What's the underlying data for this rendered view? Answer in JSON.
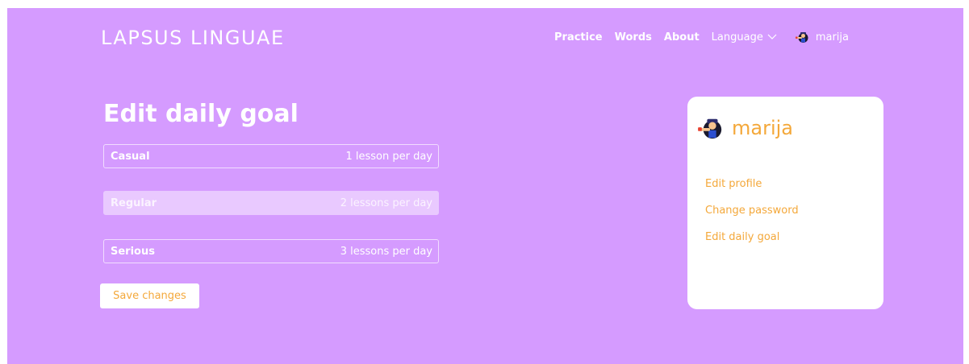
{
  "brand": "LAPSUS LINGUAE",
  "nav": {
    "practice": "Practice",
    "words": "Words",
    "about": "About",
    "language": "Language",
    "username": "marija"
  },
  "page_title": "Edit daily goal",
  "goals": [
    {
      "name": "Casual",
      "desc": "1 lesson per day",
      "selected": false
    },
    {
      "name": "Regular",
      "desc": "2 lessons per day",
      "selected": true
    },
    {
      "name": "Serious",
      "desc": "3 lessons per day",
      "selected": false
    }
  ],
  "save_label": "Save changes",
  "profile_card": {
    "username": "marija",
    "links": [
      "Edit profile",
      "Change password",
      "Edit daily goal"
    ]
  },
  "icons": {
    "avatar": "avatar-icon",
    "language_dropdown": "chevron-down-icon"
  },
  "colors": {
    "background": "#d59bff",
    "accent": "#f4a83a",
    "selected_goal": "#e9c9ff",
    "card": "#ffffff"
  }
}
